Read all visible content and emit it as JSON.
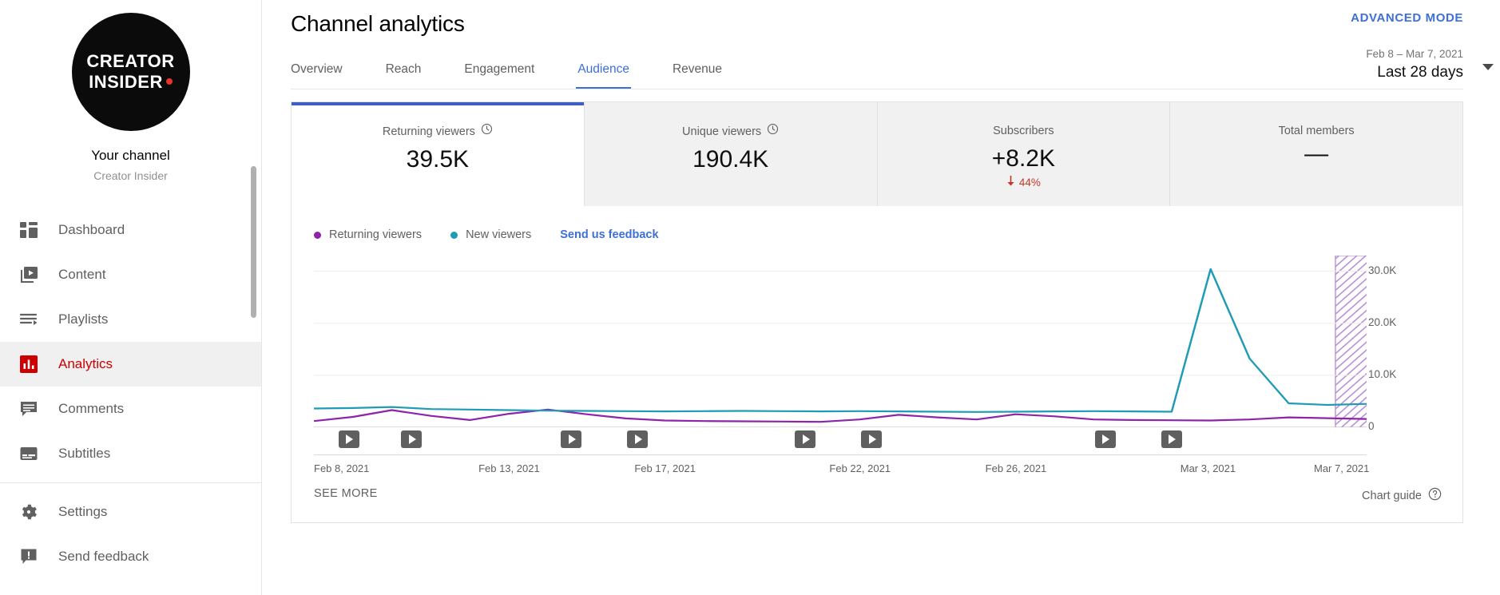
{
  "sidebar": {
    "avatar": {
      "line1": "CREATOR",
      "line2": "INSIDER",
      "dot_color": "#e8342a",
      "icon": "channel-avatar"
    },
    "your_channel_label": "Your channel",
    "channel_name": "Creator Insider",
    "items": [
      {
        "label": "Dashboard",
        "icon": "dashboard-icon",
        "active": false
      },
      {
        "label": "Content",
        "icon": "content-video-icon",
        "active": false
      },
      {
        "label": "Playlists",
        "icon": "playlists-icon",
        "active": false
      },
      {
        "label": "Analytics",
        "icon": "analytics-bar-icon",
        "active": true
      },
      {
        "label": "Comments",
        "icon": "comments-icon",
        "active": false
      },
      {
        "label": "Subtitles",
        "icon": "subtitles-icon",
        "active": false
      },
      {
        "label": "Settings",
        "icon": "gear-icon",
        "active": false
      },
      {
        "label": "Send feedback",
        "icon": "feedback-icon",
        "active": false
      }
    ],
    "active_color": "#cc0000"
  },
  "header": {
    "title": "Channel analytics",
    "advanced_mode": "ADVANCED MODE",
    "date_range_sub": "Feb 8 – Mar 7, 2021",
    "date_range_main": "Last 28 days",
    "accent_color": "#3d6fd6"
  },
  "tabs": [
    {
      "label": "Overview",
      "active": false
    },
    {
      "label": "Reach",
      "active": false
    },
    {
      "label": "Engagement",
      "active": false
    },
    {
      "label": "Audience",
      "active": true
    },
    {
      "label": "Revenue",
      "active": false
    }
  ],
  "metrics": [
    {
      "label": "Returning viewers",
      "value": "39.5K",
      "icon": "clock-icon",
      "selected": true,
      "delta": "",
      "delta_dir": ""
    },
    {
      "label": "Unique viewers",
      "value": "190.4K",
      "icon": "clock-icon",
      "selected": false,
      "delta": "",
      "delta_dir": ""
    },
    {
      "label": "Subscribers",
      "value": "+8.2K",
      "icon": "",
      "selected": false,
      "delta": "44%",
      "delta_dir": "down",
      "delta_color": "#c0392b"
    },
    {
      "label": "Total members",
      "value": "—",
      "icon": "",
      "selected": false,
      "delta": "",
      "delta_dir": ""
    }
  ],
  "legend": {
    "items": [
      {
        "label": "Returning viewers",
        "color": "#8e24aa"
      },
      {
        "label": "New viewers",
        "color": "#1f9bb5"
      }
    ],
    "feedback_link": "Send us feedback"
  },
  "footer": {
    "see_more": "SEE MORE",
    "chart_guide": "Chart guide",
    "chart_guide_icon": "help-circle-icon"
  },
  "chart_data": {
    "type": "line",
    "title": "",
    "xlabel": "",
    "ylabel": "",
    "ylim": [
      0,
      33000
    ],
    "grid": true,
    "legend_position": "top-left",
    "y_ticks": [
      {
        "label": "30.0K",
        "value": 30000
      },
      {
        "label": "20.0K",
        "value": 20000
      },
      {
        "label": "10.0K",
        "value": 10000
      },
      {
        "label": "0",
        "value": 0
      }
    ],
    "x_ticks": [
      {
        "label": "Feb 8, 2021",
        "index": 0
      },
      {
        "label": "Feb 13, 2021",
        "index": 5
      },
      {
        "label": "Feb 17, 2021",
        "index": 9
      },
      {
        "label": "Feb 22, 2021",
        "index": 14
      },
      {
        "label": "Feb 26, 2021",
        "index": 18
      },
      {
        "label": "Mar 3, 2021",
        "index": 23
      },
      {
        "label": "Mar 7, 2021",
        "index": 27
      }
    ],
    "x": [
      "Feb 8, 2021",
      "Feb 9, 2021",
      "Feb 10, 2021",
      "Feb 11, 2021",
      "Feb 12, 2021",
      "Feb 13, 2021",
      "Feb 14, 2021",
      "Feb 15, 2021",
      "Feb 16, 2021",
      "Feb 17, 2021",
      "Feb 18, 2021",
      "Feb 19, 2021",
      "Feb 20, 2021",
      "Feb 21, 2021",
      "Feb 22, 2021",
      "Feb 23, 2021",
      "Feb 24, 2021",
      "Feb 25, 2021",
      "Feb 26, 2021",
      "Feb 27, 2021",
      "Feb 28, 2021",
      "Mar 1, 2021",
      "Mar 2, 2021",
      "Mar 3, 2021",
      "Mar 4, 2021",
      "Mar 5, 2021",
      "Mar 6, 2021",
      "Mar 7, 2021"
    ],
    "series": [
      {
        "name": "New viewers",
        "color": "#1f9bb5",
        "values": [
          3600,
          3700,
          3900,
          3500,
          3400,
          3300,
          3200,
          3150,
          3100,
          3050,
          3100,
          3150,
          3100,
          3050,
          3100,
          3050,
          3000,
          2950,
          3000,
          3050,
          3100,
          3050,
          3000,
          30400,
          13200,
          4600,
          4300,
          4500
        ]
      },
      {
        "name": "Returning viewers",
        "color": "#8e24aa",
        "values": [
          1200,
          2000,
          3300,
          2200,
          1400,
          2600,
          3400,
          2500,
          1700,
          1300,
          1200,
          1150,
          1100,
          1050,
          1500,
          2400,
          1900,
          1500,
          2500,
          2100,
          1500,
          1400,
          1350,
          1300,
          1500,
          1900,
          1750,
          1600
        ]
      }
    ],
    "incomplete_region": {
      "from_index": 26.2,
      "to_index": 28,
      "color": "#b98fd6",
      "hatched": true
    },
    "video_markers": [
      {
        "index": 0.9,
        "icon": "video-play-marker"
      },
      {
        "index": 2.5,
        "icon": "video-play-marker"
      },
      {
        "index": 6.6,
        "icon": "video-play-marker"
      },
      {
        "index": 8.3,
        "icon": "video-play-marker"
      },
      {
        "index": 12.6,
        "icon": "video-play-marker"
      },
      {
        "index": 14.3,
        "icon": "video-play-marker"
      },
      {
        "index": 20.3,
        "icon": "video-play-marker"
      },
      {
        "index": 22.0,
        "icon": "video-play-marker"
      }
    ]
  }
}
